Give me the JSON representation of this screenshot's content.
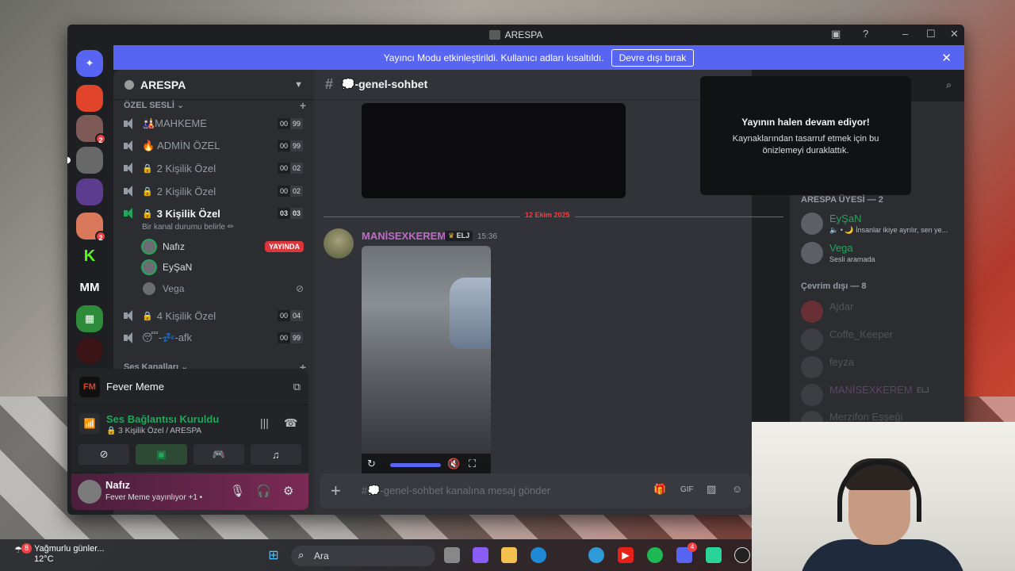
{
  "window": {
    "title": "ARESPA"
  },
  "banner": {
    "text": "Yayıncı Modu etkinleştirildi. Kullanıcı adları kısaltıldı.",
    "button": "Devre dışı bırak"
  },
  "servers": [
    {
      "badge": ""
    },
    {
      "badge": "2"
    },
    {
      "badge": ""
    },
    {
      "badge": ""
    },
    {
      "badge": "2"
    },
    {
      "label": "K"
    },
    {
      "label": "MM"
    },
    {
      "label": ""
    },
    {
      "label": ""
    }
  ],
  "guild": {
    "name": "ARESPA"
  },
  "sidebar": {
    "category_private": "ÖZEL SESLİ",
    "category_voice": "Ses Kanalları",
    "channels": [
      {
        "name": "🎎MAHKEME",
        "a": "00",
        "b": "99"
      },
      {
        "name": "🔥 ADMİN ÖZEL",
        "a": "00",
        "b": "99"
      },
      {
        "name": "2 Kişilik Özel",
        "a": "00",
        "b": "02"
      },
      {
        "name": "2 Kişilik Özel",
        "a": "00",
        "b": "02"
      },
      {
        "name": "3 Kişilik Özel",
        "a": "03",
        "b": "03"
      },
      {
        "name": "4 Kişilik Özel",
        "a": "00",
        "b": "04"
      },
      {
        "name": "😴-💤-afk",
        "a": "00",
        "b": "99"
      }
    ],
    "channel_status": "Bir kanal durumu belirle ✏",
    "voice_users": [
      {
        "name": "Nafız",
        "live": "YAYINDA"
      },
      {
        "name": "EyŞaN"
      },
      {
        "name": "Vega"
      }
    ]
  },
  "stream_card": {
    "title": "Fever Meme",
    "fm": "FM",
    "conn_title": "Ses Bağlantısı Kuruldu",
    "conn_sub": "🔒 3 Kişilik Özel / ARESPA"
  },
  "user": {
    "name": "Nafız",
    "status": "Fever Meme yayınlıyor +1 •"
  },
  "chat": {
    "channel": "💭-genel-sohbet",
    "date_divider": "12 Ekim 2025",
    "message": {
      "author": "MANİSEXKEREM",
      "tag": "ELJ",
      "time": "15:36"
    },
    "placeholder": "#💭-genel-sohbet kanalına mesaj gönder"
  },
  "popup": {
    "title": "Yayının halen devam ediyor!",
    "body": "Kaynaklarından tasarruf etmek için bu önizlemeyi duraklattık."
  },
  "members": {
    "online_header": "ARESPA ÜYESİ — 2",
    "online": [
      {
        "name": "EyŞaN",
        "sub": "🔈 • 🌙 İnsanlar ikiye ayrılır, sen ye..."
      },
      {
        "name": "Vega",
        "sub": "Sesli aramada"
      }
    ],
    "offline_header": "Çevrim dışı — 8",
    "offline": [
      {
        "name": "Ajdar"
      },
      {
        "name": "Coffe_Keeper"
      },
      {
        "name": "feyza"
      },
      {
        "name": "MANİSEXKEREM",
        "tag": "ELJ"
      },
      {
        "name": "Merzifon Eşşeği"
      }
    ]
  },
  "taskbar": {
    "weather_title": "Yağmurlu günler...",
    "weather_temp": "12°C",
    "weather_badge": "8",
    "search_placeholder": "Ara",
    "discord_badge": "4"
  }
}
